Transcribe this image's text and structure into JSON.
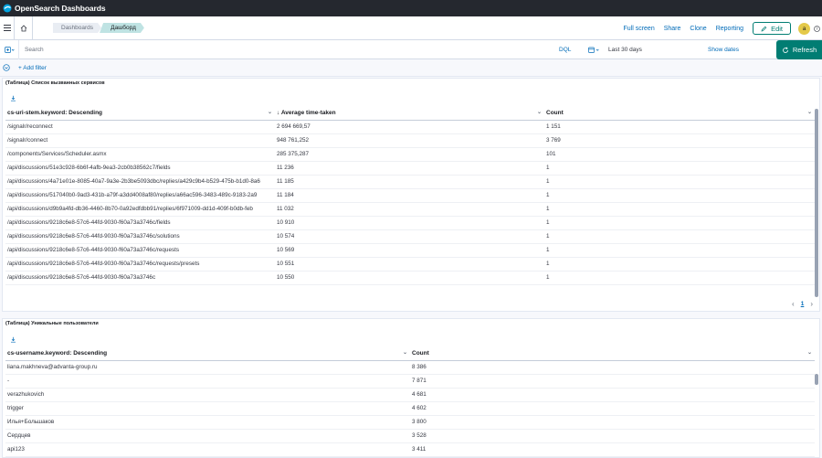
{
  "app": {
    "title": "OpenSearch Dashboards"
  },
  "breadcrumbs": [
    "Dashboards",
    "Дашборд"
  ],
  "nav": {
    "full_screen": "Full screen",
    "share": "Share",
    "clone": "Clone",
    "reporting": "Reporting",
    "edit": "Edit",
    "avatar": "a"
  },
  "query": {
    "placeholder": "Search",
    "language": "DQL",
    "date": "Last 30 days",
    "show_dates": "Show dates",
    "refresh": "Refresh"
  },
  "filters": {
    "add": "+ Add filter"
  },
  "panel1": {
    "title": "(Таблица) Список вызванных сервисов",
    "columns": [
      "cs-uri-stem.keyword: Descending",
      "Average time-taken",
      "Count"
    ],
    "rows": [
      [
        "/signalr/reconnect",
        "2 694 669,57",
        "1 151"
      ],
      [
        "/signalr/connect",
        "948 761,252",
        "3 769"
      ],
      [
        "/components/Services/Scheduler.asmx",
        "285 375,287",
        "101"
      ],
      [
        "/api/discussions/51e3c928-6b6f-4afb-9ea3-2cb0b38562c7/fields",
        "11 236",
        "1"
      ],
      [
        "/api/discussions/4a71e01e-8085-40a7-9a3e-2b3be5093dbc/replies/a429c9b4-b529-475b-b1d0-8a6",
        "11 185",
        "1"
      ],
      [
        "/api/discussions/517040b0-9ad3-431b-a79f-a3dd4008af80/replies/a66ac596-3483-489c-9183-2a9",
        "11 184",
        "1"
      ],
      [
        "/api/discussions/d9b9a4fd-db36-4460-8b70-0a92edfdbb91/replies/6f971009-dd1d-409f-b0db-feb",
        "11 032",
        "1"
      ],
      [
        "/api/discussions/9218c6e8-57c6-44fd-9030-f60a73a3746c/fields",
        "10 910",
        "1"
      ],
      [
        "/api/discussions/9218c6e8-57c6-44fd-9030-f60a73a3746c/solutions",
        "10 574",
        "1"
      ],
      [
        "/api/discussions/9218c6e8-57c6-44fd-9030-f60a73a3746c/requests",
        "10 569",
        "1"
      ],
      [
        "/api/discussions/9218c6e8-57c6-44fd-9030-f60a73a3746c/requests/presets",
        "10 551",
        "1"
      ],
      [
        "/api/discussions/9218c6e8-57c6-44fd-9030-f60a73a3746c",
        "10 550",
        "1"
      ]
    ],
    "page": "1"
  },
  "panel2": {
    "title": "(Таблица) Уникальные пользователи",
    "columns": [
      "cs-username.keyword: Descending",
      "Count"
    ],
    "rows": [
      [
        "liana.makhneva@advanta-group.ru",
        "8 386"
      ],
      [
        "-",
        "7 871"
      ],
      [
        "verazhukovich",
        "4 681"
      ],
      [
        "trigger",
        "4 602"
      ],
      [
        "Илья+Большаков",
        "3 800"
      ],
      [
        "Сердцев",
        "3 528"
      ],
      [
        "api123",
        "3 411"
      ]
    ]
  },
  "colors": {
    "topbar": "#25282f",
    "accent": "#017d73",
    "link": "#006bb8"
  }
}
